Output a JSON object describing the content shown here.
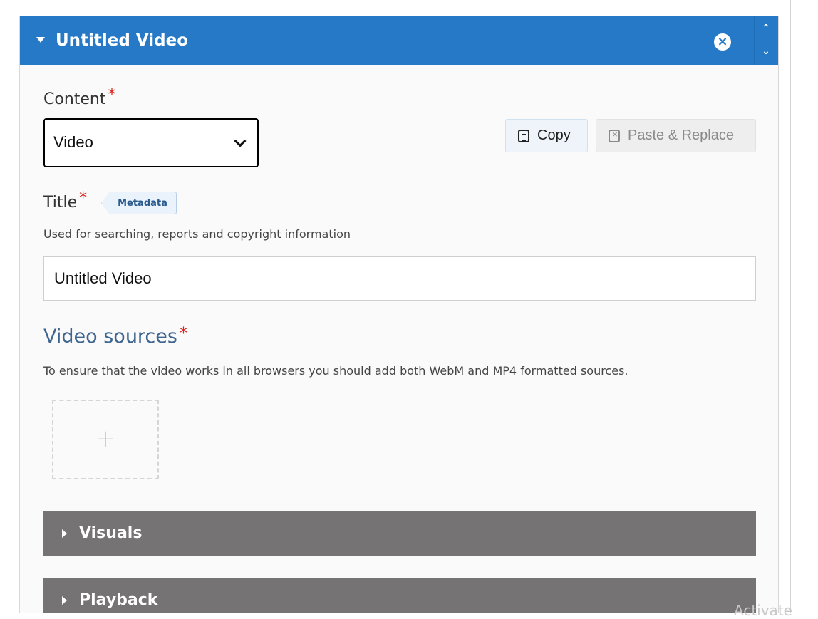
{
  "header": {
    "title": "Untitled Video",
    "close_glyph": "×",
    "order_up": "⌃",
    "order_down": "⌄"
  },
  "content_field": {
    "label": "Content",
    "required_mark": "*",
    "selected_value": "Video"
  },
  "toolbar": {
    "copy_label": "Copy",
    "paste_label": "Paste & Replace"
  },
  "title_field": {
    "label": "Title",
    "required_mark": "*",
    "tag": "Metadata",
    "description": "Used for searching, reports and copyright information",
    "value": "Untitled Video"
  },
  "video_sources": {
    "title": "Video sources",
    "required_mark": "*",
    "description": "To ensure that the video works in all browsers you should add both WebM and MP4 formatted sources.",
    "add_glyph": "+"
  },
  "groups": [
    {
      "label": "Visuals"
    },
    {
      "label": "Playback"
    }
  ],
  "watermark": "Activate",
  "colors": {
    "header_blue": "#2579c6",
    "required_red": "#d9231a",
    "section_title": "#3e6590",
    "group_bar": "#757374"
  },
  "icons": {
    "header_caret": "caret-down-icon",
    "close": "close-circle-icon",
    "copy": "copy-icon",
    "paste": "paste-icon",
    "add": "plus-icon",
    "group_caret": "caret-right-icon"
  }
}
